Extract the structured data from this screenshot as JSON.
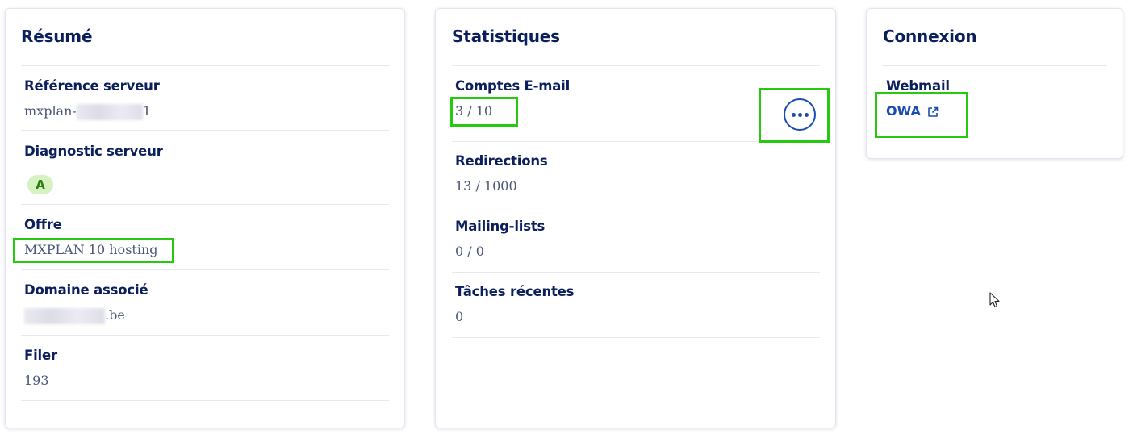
{
  "resume": {
    "title": "Résumé",
    "reference_label": "Référence serveur",
    "reference_prefix": "mxplan-",
    "reference_suffix": "1",
    "diagnostic_label": "Diagnostic serveur",
    "diagnostic_grade": "A",
    "offre_label": "Offre",
    "offre_value": "MXPLAN 10 hosting",
    "domaine_label": "Domaine associé",
    "domaine_suffix": ".be",
    "filer_label": "Filer",
    "filer_value": "193"
  },
  "stats": {
    "title": "Statistiques",
    "comptes_label": "Comptes E-mail",
    "comptes_value": "3 / 10",
    "redirections_label": "Redirections",
    "redirections_value": "13 / 1000",
    "mailing_label": "Mailing-lists",
    "mailing_value": "0 / 0",
    "taches_label": "Tâches récentes",
    "taches_value": "0"
  },
  "connexion": {
    "title": "Connexion",
    "webmail_label": "Webmail",
    "owa_link": "OWA"
  },
  "colors": {
    "title": "#0b1f5c",
    "value": "#4a5578",
    "link": "#1a4db3",
    "highlight": "#25c90f",
    "badge_bg": "#d7f2c1",
    "badge_fg": "#2e7d16"
  }
}
